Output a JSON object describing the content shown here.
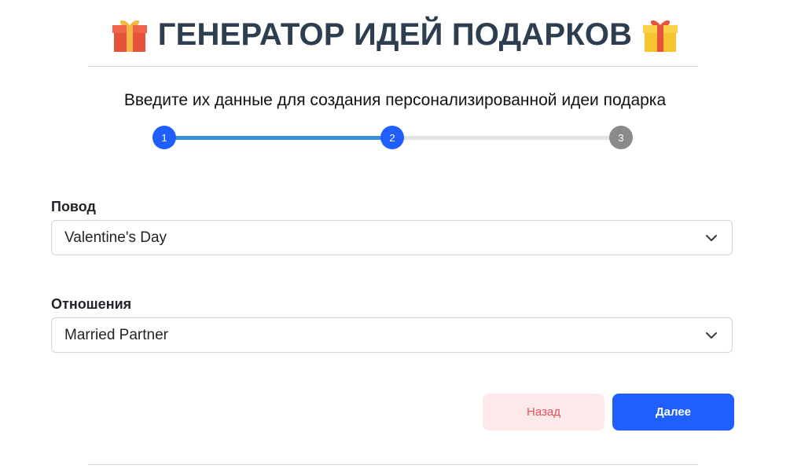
{
  "header": {
    "title": "ГЕНЕРАТОР ИДЕЙ ПОДАРКОВ",
    "left_icon": "gift-icon",
    "right_icon": "gift-icon"
  },
  "subtitle": "Введите их данные для создания персонализированной идеи подарка",
  "stepper": {
    "steps": [
      {
        "label": "1",
        "state": "active"
      },
      {
        "label": "2",
        "state": "active"
      },
      {
        "label": "3",
        "state": "inactive"
      }
    ],
    "current_step": 2,
    "total_steps": 3,
    "progress_fraction": 0.5,
    "colors": {
      "active": "#1f5eff",
      "inactive": "#8a8a8a",
      "track_fill": "#3a8fdc",
      "track": "#e3e3e3"
    }
  },
  "form": {
    "occasion": {
      "label": "Повод",
      "value": "Valentine's Day",
      "icon": "chevron-down-icon"
    },
    "relationship": {
      "label": "Отношения",
      "value": "Married Partner",
      "icon": "chevron-down-icon"
    }
  },
  "buttons": {
    "back_label": "Назад",
    "next_label": "Далее",
    "back_color": "#fde8ea",
    "back_text_color": "#e8505b",
    "next_color": "#1f5eff"
  }
}
